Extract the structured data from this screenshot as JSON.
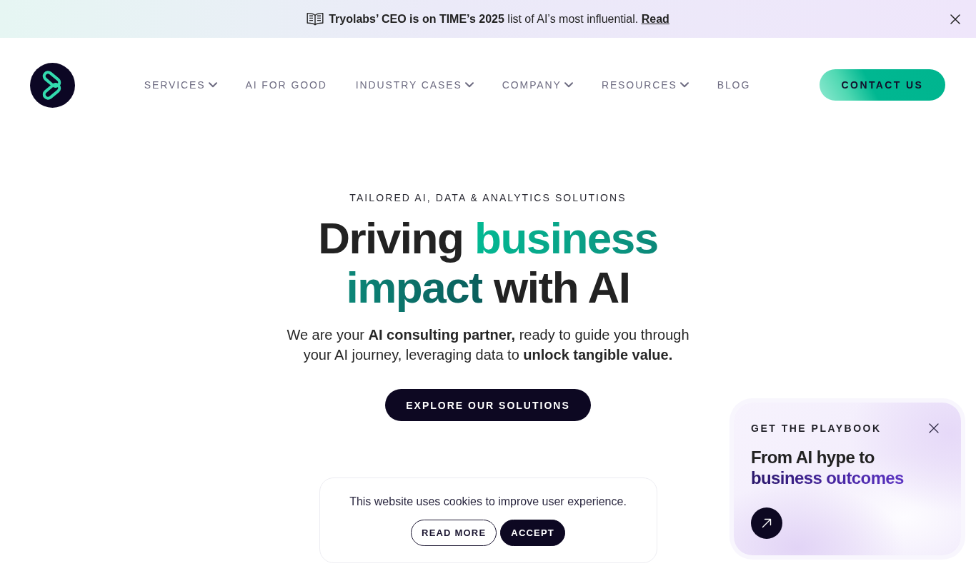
{
  "announcement": {
    "text": "**Tryolabs’ CEO is on TIME’s 2025** list of AI’s most influential.",
    "link": "Read"
  },
  "header": {
    "nav": [
      {
        "label": "SERVICES",
        "has_menu": true
      },
      {
        "label": "AI FOR GOOD",
        "has_menu": false
      },
      {
        "label": "INDUSTRY CASES",
        "has_menu": true
      },
      {
        "label": "COMPANY",
        "has_menu": true
      },
      {
        "label": "RESOURCES",
        "has_menu": true
      },
      {
        "label": "BLOG",
        "has_menu": false
      }
    ],
    "cta": "CONTACT US"
  },
  "hero": {
    "eyebrow": "TAILORED AI, DATA & ANALYTICS SOLUTIONS",
    "headline": [
      {
        "text": "Driving",
        "kind": "plain"
      },
      {
        "text": "business impact",
        "kind": "accent"
      },
      {
        "text": "with AI",
        "kind": "plain"
      }
    ],
    "lead": "We are your **AI consulting partner,** ready to guide you through your AI journey, leveraging data to **unlock tangible value.**",
    "button": "EXPLORE OUR SOLUTIONS"
  },
  "cookie_banner": {
    "text": "This website uses cookies to improve user experience.",
    "buttons": [
      {
        "label": "READ MORE",
        "kind": "outline"
      },
      {
        "label": "ACCEPT",
        "kind": "filled"
      }
    ]
  },
  "playbook_card": {
    "eyebrow": "GET THE PLAYBOOK",
    "title": [
      {
        "text": "From AI hype to",
        "kind": "plain"
      },
      {
        "text": "business outcomes",
        "kind": "accent"
      }
    ]
  }
}
